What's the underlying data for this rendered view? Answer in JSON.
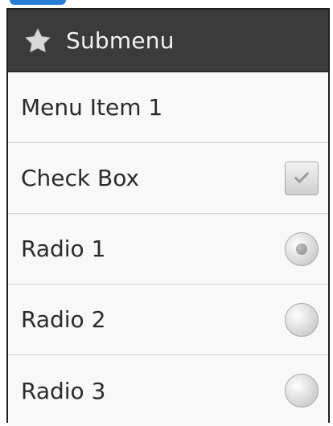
{
  "submenu": {
    "title": "Submenu",
    "header_icon": "star-icon"
  },
  "items": [
    {
      "label": "Menu Item 1",
      "control": "none"
    },
    {
      "label": "Check Box",
      "control": "checkbox",
      "checked": true
    },
    {
      "label": "Radio 1",
      "control": "radio",
      "selected": true
    },
    {
      "label": "Radio 2",
      "control": "radio",
      "selected": false
    },
    {
      "label": "Radio 3",
      "control": "radio",
      "selected": false
    }
  ],
  "colors": {
    "header_bg": "#3b3b3b",
    "header_text": "#f2f2f2",
    "menu_bg": "#f8f8f8",
    "divider": "#d2d2d2",
    "top_blue_fragment": "#1976d2"
  }
}
